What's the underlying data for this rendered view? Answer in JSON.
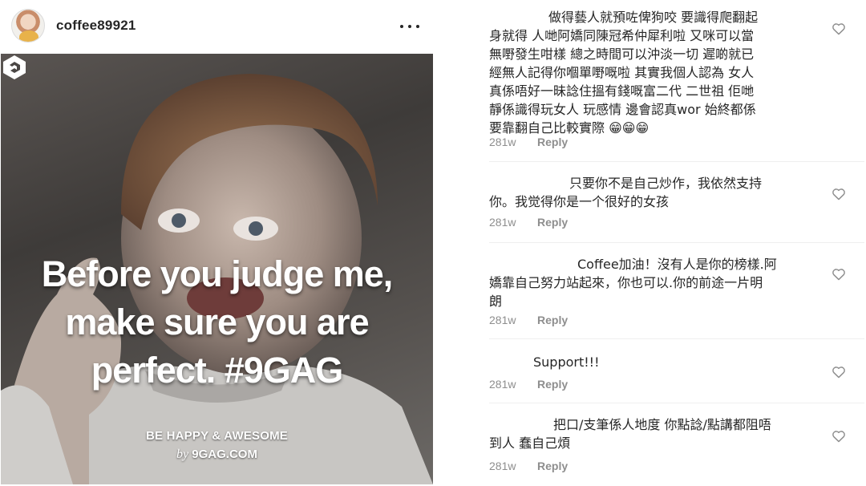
{
  "post": {
    "username": "coffee89921",
    "image": {
      "logo": "9gag-logo",
      "caption_lines": [
        "Before you judge me,",
        "make sure you are",
        "perfect. #9GAG"
      ],
      "brand_tagline": "BE HAPPY & AWESOME",
      "brand_by": "by",
      "brand_site": "9GAG.COM"
    }
  },
  "comments": [
    {
      "lines": [
        "做得藝人就預咗俾狗咬  要識得爬翻起",
        "身就得  人哋阿嬌同陳冠希仲犀利啦  又咪可以當",
        "無嘢發生咁樣 總之時間可以沖淡一切  遲啲就已",
        "經無人記得你嗰單嘢嘅啦  其實我個人認為 女人",
        "真係唔好一昧諗住搵有錢嘅富二代 二世祖 佢哋",
        "靜係識得玩女人 玩感情 邊會認真wor 始終都係",
        "要靠翻自己比較實際 😁😁😁"
      ],
      "age": "281w",
      "reply": "Reply"
    },
    {
      "lines": [
        "只要你不是自己炒作，我依然支持",
        "你。我觉得你是一个很好的女孩"
      ],
      "age": "281w",
      "reply": "Reply"
    },
    {
      "lines": [
        "Coffee加油！沒有人是你的榜樣.阿",
        "嬌靠自己努力站起來，你也可以.你的前途一片明",
        "朗"
      ],
      "age": "281w",
      "reply": "Reply"
    },
    {
      "lines": [
        "Support!!!"
      ],
      "age": "281w",
      "reply": "Reply"
    },
    {
      "lines": [
        "把口/支筆係人地度 你點諗/點講都阻唔",
        "到人 蠢自己煩"
      ],
      "age": "281w",
      "reply": "Reply"
    }
  ],
  "icons": {
    "more": "more-options-icon",
    "like": "heart-icon"
  },
  "colors": {
    "text": "#262626",
    "muted": "#8e8e8e",
    "divider": "#efefef",
    "caption": "#ffffff"
  }
}
